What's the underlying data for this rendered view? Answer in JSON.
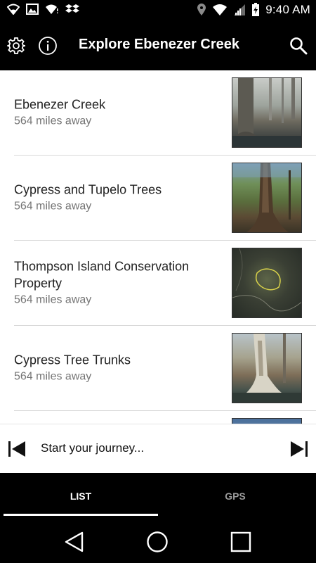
{
  "status_bar": {
    "time": "9:40 AM",
    "left_icons": [
      "wifi-icon",
      "image-icon",
      "wifi-alert-icon",
      "dropbox-icon"
    ],
    "right_icons": [
      "location-icon",
      "wifi-icon",
      "signal-icon",
      "battery-icon"
    ]
  },
  "app_bar": {
    "title": "Explore Ebenezer Creek",
    "left_icons": [
      "gear-icon",
      "info-icon"
    ],
    "right_icon": "search-icon"
  },
  "places": [
    {
      "name": "Ebenezer Creek",
      "distance": "564 miles away"
    },
    {
      "name": "Cypress and Tupelo Trees",
      "distance": "564 miles away"
    },
    {
      "name": "Thompson Island Conservation Property",
      "distance": "564 miles away"
    },
    {
      "name": "Cypress Tree Trunks",
      "distance": "564 miles away"
    }
  ],
  "player": {
    "prompt": "Start your journey...",
    "prev_icon": "skip-previous-icon",
    "next_icon": "skip-next-icon"
  },
  "tabs": [
    {
      "label": "LIST",
      "active": true
    },
    {
      "label": "GPS",
      "active": false
    }
  ],
  "nav": {
    "icons": [
      "back-icon",
      "home-icon",
      "recents-icon"
    ]
  },
  "colors": {
    "bar_background": "#000000",
    "secondary_text": "#757575",
    "inactive_tab": "#9a9a9a"
  }
}
